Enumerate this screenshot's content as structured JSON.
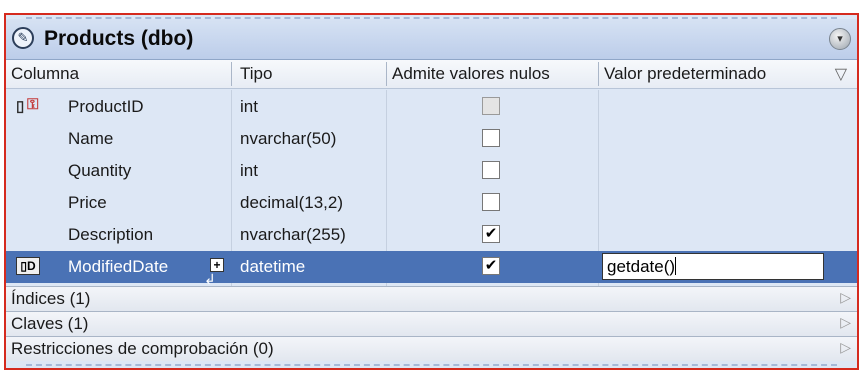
{
  "table": {
    "title": "Products (dbo)"
  },
  "icons": {
    "edit": "pencil-icon",
    "collapse": "chevron-down-icon",
    "filter": "filter-icon",
    "key": "primary-key-icon",
    "column": "column-icon",
    "plus": "plus-icon",
    "section_arrow": "triangle-right-icon"
  },
  "columns": {
    "headers": {
      "column": "Columna",
      "type": "Tipo",
      "nullable": "Admite valores nulos",
      "default": "Valor predeterminado"
    },
    "rows": [
      {
        "name": "ProductID",
        "type": "int",
        "nullable": false,
        "nullable_disabled": true,
        "default": ""
      },
      {
        "name": "Name",
        "type": "nvarchar(50)",
        "nullable": false,
        "default": ""
      },
      {
        "name": "Quantity",
        "type": "int",
        "nullable": false,
        "default": ""
      },
      {
        "name": "Price",
        "type": "decimal(13,2)",
        "nullable": false,
        "default": ""
      },
      {
        "name": "Description",
        "type": "nvarchar(255)",
        "nullable": true,
        "default": ""
      },
      {
        "name": "ModifiedDate",
        "type": "datetime",
        "nullable": true,
        "default": "getdate()",
        "selected": true
      }
    ]
  },
  "sections": [
    {
      "label": "Índices (1)"
    },
    {
      "label": "Claves (1)"
    },
    {
      "label": "Restricciones de comprobación (0)"
    }
  ],
  "colors": {
    "selection": "#4a72b5",
    "window_border": "#d52a1e",
    "panel_background": "#dde7f5"
  }
}
